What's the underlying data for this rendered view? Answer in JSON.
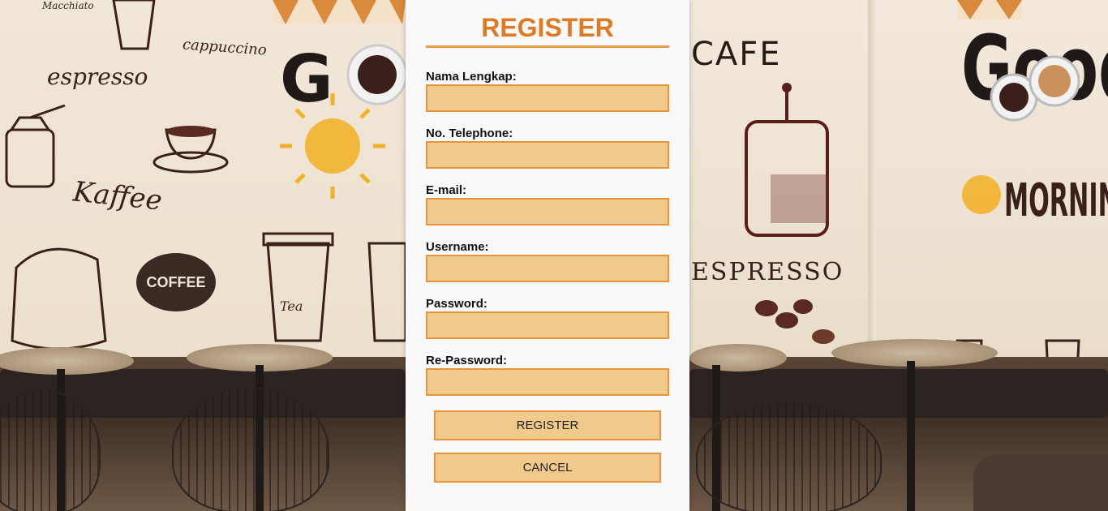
{
  "form": {
    "title": "REGISTER",
    "fields": [
      {
        "label": "Nama Lengkap:",
        "value": "",
        "type": "text"
      },
      {
        "label": "No. Telephone:",
        "value": "",
        "type": "text"
      },
      {
        "label": "E-mail:",
        "value": "",
        "type": "email"
      },
      {
        "label": "Username:",
        "value": "",
        "type": "text"
      },
      {
        "label": "Password:",
        "value": "",
        "type": "password"
      },
      {
        "label": "Re-Password:",
        "value": "",
        "type": "password"
      }
    ],
    "register_button": "REGISTER",
    "cancel_button": "CANCEL"
  },
  "background": {
    "left_words": [
      "Macchiato",
      "cappuccino",
      "espresso",
      "Kaffee",
      "COFFEE",
      "Tea"
    ],
    "right_words": [
      "CAFE",
      "ESPRESSO",
      "MORNING",
      "Good"
    ]
  },
  "colors": {
    "accent": "#e07a22",
    "input_fill": "#f0ca8a",
    "input_border": "#e8943c",
    "panel": "#f9f9f9"
  }
}
